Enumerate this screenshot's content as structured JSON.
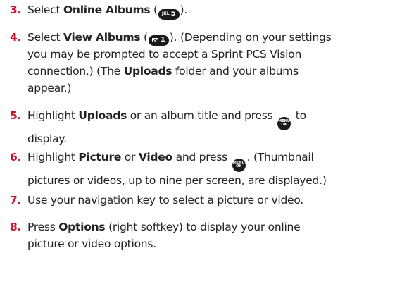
{
  "colors": {
    "step_number": "#c8102e",
    "text": "#222222",
    "key_bg": "#1a1a1a"
  },
  "icons": {
    "jkl5": "jkl-5-key-icon",
    "msg1": "envelope-1-key-icon",
    "menuok": "menu-ok-key-icon"
  },
  "steps": [
    {
      "num": "3.",
      "t1": "Select ",
      "b1": "Online Albums",
      "t2": " (",
      "key_small": "JKL",
      "key_digit": "5",
      "t3": ")."
    },
    {
      "num": "4.",
      "t1": "Select ",
      "b1": "View Albums",
      "t2": " (",
      "key_digit": "1",
      "t3": "). (Depending on your settings",
      "l2": "you may be prompted to accept a Sprint PCS Vision",
      "l3a": "connection.) (The ",
      "l3b": "Uploads",
      "l3c": " folder and your albums",
      "l4": "appear.)"
    },
    {
      "num": "5.",
      "t1": "Highlight ",
      "b1": "Uploads",
      "t2": " or an album title and press ",
      "t3": " to",
      "l2": "display."
    },
    {
      "num": "6.",
      "t1": "Highlight ",
      "b1": "Picture",
      "t2": " or ",
      "b2": "Video",
      "t3": " and press ",
      "t4": ". (Thumbnail",
      "l2": "pictures or videos, up to nine per screen, are displayed.)"
    },
    {
      "num": "7.",
      "t1": "Use your navigation key to select a picture or video."
    },
    {
      "num": "8.",
      "t1": "Press ",
      "b1": "Options",
      "t2": " (right softkey) to display your online",
      "l2": "picture or video options."
    }
  ],
  "menuok": {
    "top": "MENU",
    "bottom": "OK"
  }
}
